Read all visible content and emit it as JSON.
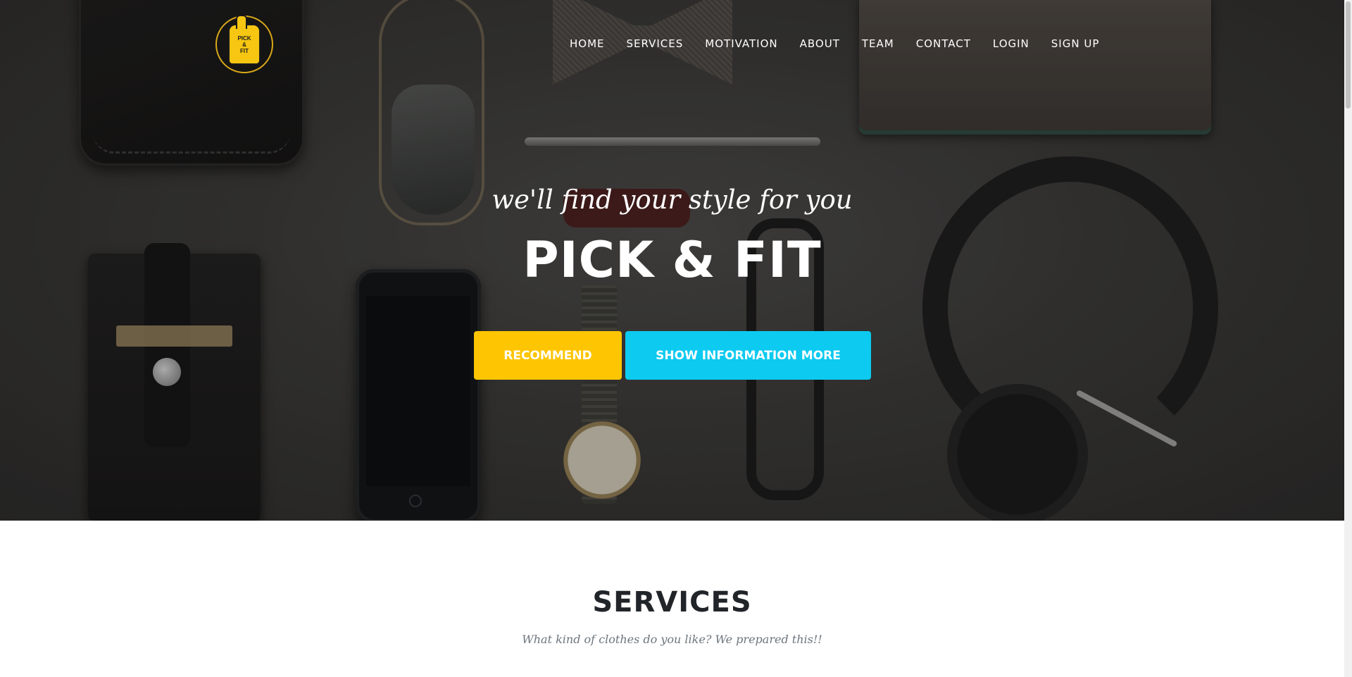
{
  "nav": {
    "logo_text": [
      "PICK",
      "&",
      "FIT"
    ],
    "items": [
      {
        "label": "HOME"
      },
      {
        "label": "SERVICES"
      },
      {
        "label": "MOTIVATION"
      },
      {
        "label": "ABOUT"
      },
      {
        "label": "TEAM"
      },
      {
        "label": "CONTACT"
      },
      {
        "label": "LOGIN"
      },
      {
        "label": "SIGN UP"
      }
    ]
  },
  "hero": {
    "tagline": "we'll find your style for you",
    "title": "PICK & FIT",
    "recommend_label": "RECOMMEND",
    "info_label": "SHOW INFORMATION MORE"
  },
  "services": {
    "title": "SERVICES",
    "subtitle": "What kind of clothes do you like? We prepared this!!"
  },
  "colors": {
    "primary_yellow": "#fec503",
    "info_cyan": "#0dcaf0",
    "heading_dark": "#212529",
    "muted": "#6c757d"
  }
}
